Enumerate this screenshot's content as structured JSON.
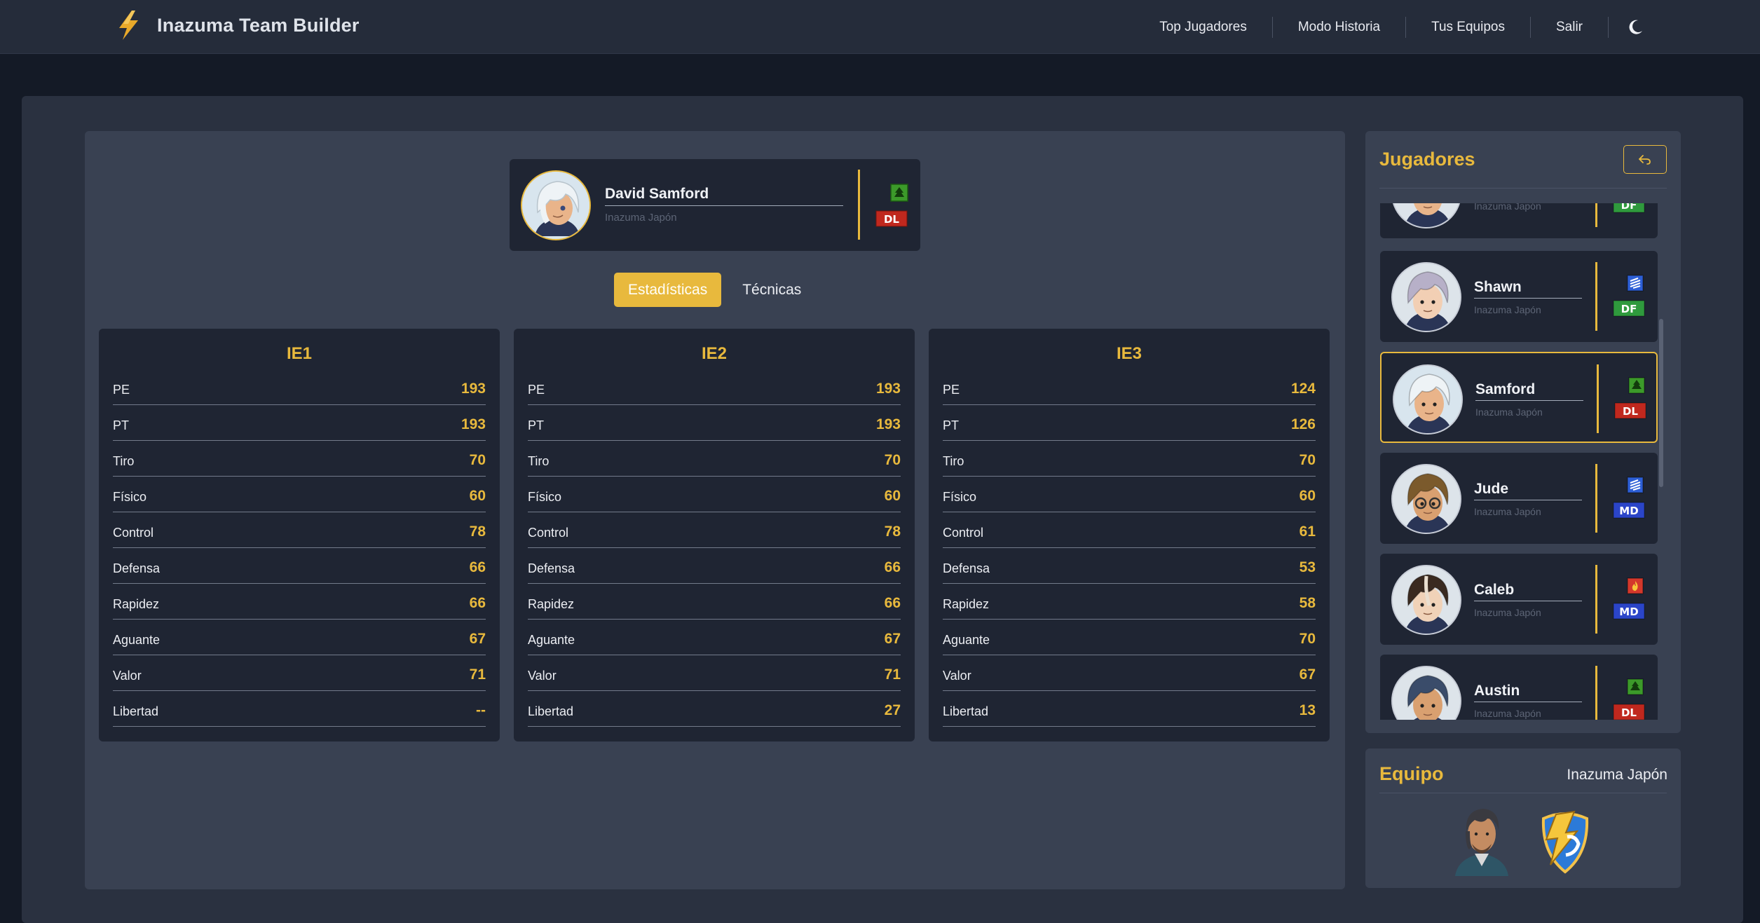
{
  "app": {
    "title": "Inazuma Team Builder",
    "logo_icon": "lightning-bolt-icon"
  },
  "nav": {
    "items": [
      "Top Jugadores",
      "Modo Historia",
      "Tus Equipos",
      "Salir"
    ],
    "theme_toggle_icon": "moon-icon"
  },
  "player": {
    "name": "David Samford",
    "team": "Inazuma Japón",
    "element_icon": "wood-element-icon",
    "position": "DL"
  },
  "tabs": [
    {
      "label": "Estadísticas",
      "active": true
    },
    {
      "label": "Técnicas",
      "active": false
    }
  ],
  "stat_labels": [
    "PE",
    "PT",
    "Tiro",
    "Físico",
    "Control",
    "Defensa",
    "Rapidez",
    "Aguante",
    "Valor",
    "Libertad"
  ],
  "stats": [
    {
      "game": "IE1",
      "values": [
        "193",
        "193",
        "70",
        "60",
        "78",
        "66",
        "66",
        "67",
        "71",
        "--"
      ]
    },
    {
      "game": "IE2",
      "values": [
        "193",
        "193",
        "70",
        "60",
        "78",
        "66",
        "66",
        "67",
        "71",
        "27"
      ]
    },
    {
      "game": "IE3",
      "values": [
        "124",
        "126",
        "70",
        "60",
        "61",
        "53",
        "58",
        "70",
        "67",
        "13"
      ]
    }
  ],
  "sidebar": {
    "title": "Jugadores",
    "back_icon": "back-arrow-icon",
    "players": [
      {
        "name": "",
        "team": "Inazuma Japón",
        "element": "wood",
        "position": "DF",
        "selected": false
      },
      {
        "name": "Shawn",
        "team": "Inazuma Japón",
        "element": "wind",
        "position": "DF",
        "selected": false
      },
      {
        "name": "Samford",
        "team": "Inazuma Japón",
        "element": "wood",
        "position": "DL",
        "selected": true
      },
      {
        "name": "Jude",
        "team": "Inazuma Japón",
        "element": "wind",
        "position": "MD",
        "selected": false
      },
      {
        "name": "Caleb",
        "team": "Inazuma Japón",
        "element": "fire",
        "position": "MD",
        "selected": false
      },
      {
        "name": "Austin",
        "team": "Inazuma Japón",
        "element": "wood",
        "position": "DL",
        "selected": false
      }
    ]
  },
  "team": {
    "title": "Equipo",
    "name": "Inazuma Japón",
    "coach_icon": "coach-portrait-icon",
    "emblem_icon": "team-emblem-icon"
  },
  "colors": {
    "accent": "#e8b93d",
    "bg": "#141a26",
    "panel": "#394152",
    "card": "#1f2533",
    "pos_df": "#2f9a3d",
    "pos_dl": "#c0281e",
    "pos_md": "#2b45c8",
    "elem_wood": "#3c9a2a",
    "elem_wind": "#2d5fd6",
    "elem_fire": "#d4382c"
  }
}
